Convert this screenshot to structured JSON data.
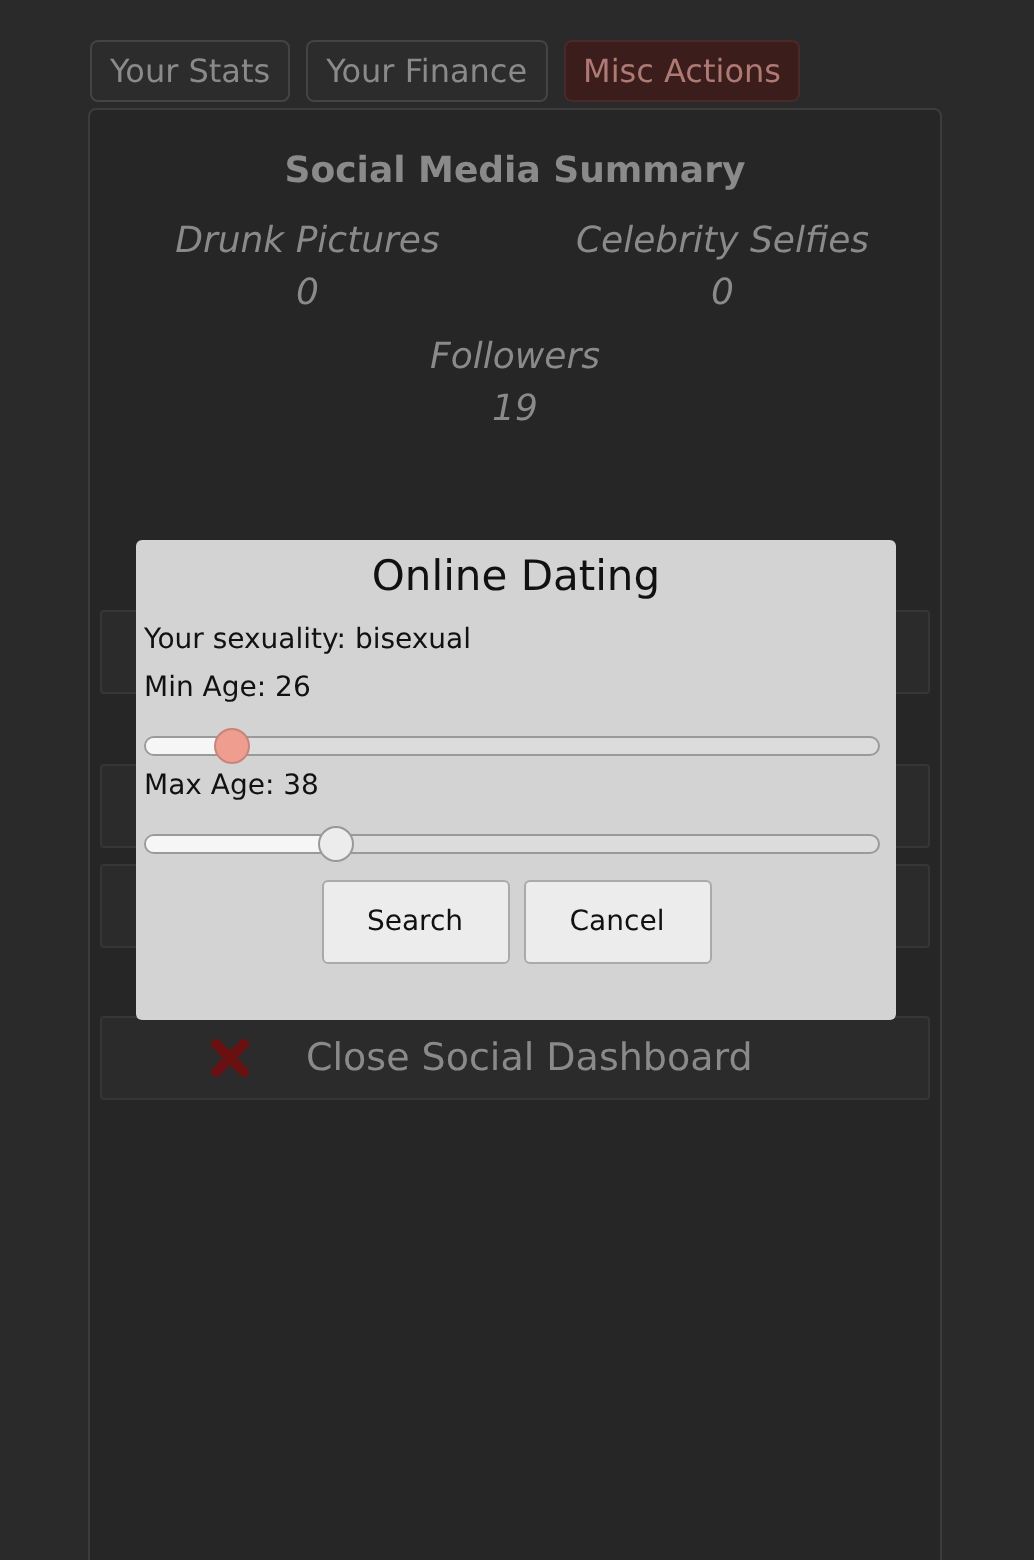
{
  "tabs": [
    {
      "label": "Your Stats",
      "selected": false
    },
    {
      "label": "Your Finance",
      "selected": false
    },
    {
      "label": "Misc Actions",
      "selected": true
    }
  ],
  "summary": {
    "title": "Social Media Summary",
    "stats": [
      {
        "label": "Drunk Pictures",
        "value": "0"
      },
      {
        "label": "Celebrity Selfies",
        "value": "0"
      },
      {
        "label": "Followers",
        "value": "19"
      }
    ]
  },
  "close_action": {
    "label": "Close Social Dashboard"
  },
  "dialog": {
    "title": "Online Dating",
    "sexuality": "Your sexuality: bisexual",
    "sliders": [
      {
        "label": "Min Age: 26",
        "level": 0.12,
        "focused": true
      },
      {
        "label": "Max Age: 38",
        "level": 0.26,
        "focused": false
      }
    ],
    "buttons": [
      "Search",
      "Cancel"
    ]
  }
}
